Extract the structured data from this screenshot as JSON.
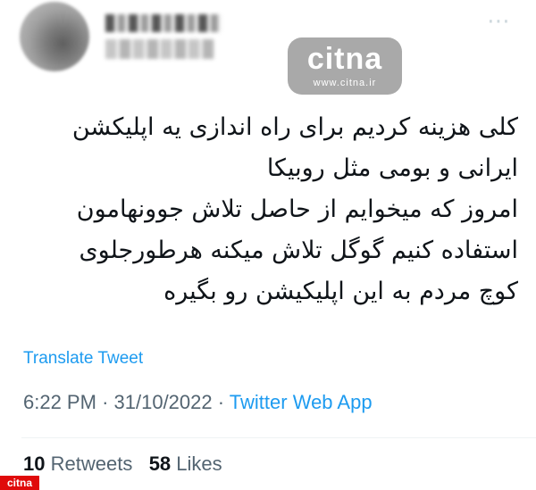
{
  "header": {
    "more_icon": "more-horizontal-icon"
  },
  "watermark": {
    "logo": "citna",
    "url": "www.citna.ir"
  },
  "tweet": {
    "lines": [
      "کلی هزینه کردیم برای راه اندازی یه اپلیکشن",
      "ایرانی و بومی مثل روبیکا",
      "امروز که میخوایم از حاصل تلاش جوونهامون",
      "استفاده کنیم گوگل تلاش میکنه هرطورجلوی",
      "کوچ مردم به این اپلیکیشن رو بگیره"
    ],
    "translate_label": "Translate Tweet",
    "time": "6:22 PM",
    "date": "31/10/2022",
    "separator": "·",
    "source": "Twitter Web App",
    "retweets_count": "10",
    "retweets_label": "Retweets",
    "likes_count": "58",
    "likes_label": "Likes"
  },
  "corner_logo": {
    "text": "citna",
    "color": "#e00a0a"
  },
  "colors": {
    "link": "#1d9bf0",
    "secondary_text": "#536471",
    "primary_text": "#0f1419"
  }
}
